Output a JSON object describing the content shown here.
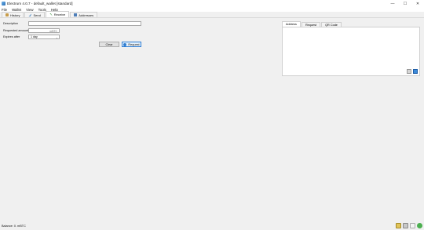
{
  "window": {
    "title": "Electrum 4.0.7  -  default_wallet  [standard]",
    "controls": {
      "minimize": "—",
      "maximize": "☐",
      "close": "✕"
    }
  },
  "menu": {
    "items": [
      "File",
      "Wallet",
      "View",
      "Tools",
      "Help"
    ]
  },
  "tabs": [
    {
      "label": "History",
      "icon": "history-icon"
    },
    {
      "label": "Send",
      "icon": "send-icon"
    },
    {
      "label": "Receive",
      "icon": "receive-icon",
      "active": true
    },
    {
      "label": "Addresses",
      "icon": "addresses-icon"
    }
  ],
  "receive": {
    "description_label": "Description",
    "description_value": "",
    "amount_label": "Requested amount",
    "amount_value": "",
    "amount_unit": "mBTC",
    "expires_label": "Expires after",
    "expires_value": "1 day",
    "clear_label": "Clear",
    "request_label": "Request"
  },
  "panel": {
    "tabs": [
      "Address",
      "Request",
      "QR Code"
    ],
    "active_tab": "Address"
  },
  "status": {
    "balance_text": "Balance: 0. mBTC"
  }
}
